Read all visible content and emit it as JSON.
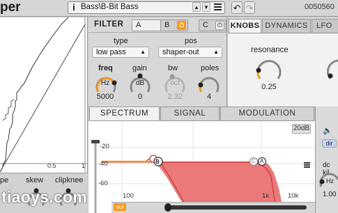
{
  "app": {
    "title_fragment": "per"
  },
  "preset": {
    "name": "Bass\\B-Bit Bass",
    "info_glyph": "i",
    "up_glyph": "▲",
    "down_glyph": "▼"
  },
  "toolbar": {
    "undo_glyph": "↶",
    "redo_glyph": "↷",
    "sample_counter": "0050560"
  },
  "shaper": {
    "tick_05": "0.5",
    "tick_1": "1",
    "knobs": [
      {
        "label": "pe"
      },
      {
        "label": "skew"
      },
      {
        "label": "clipknee"
      }
    ]
  },
  "filter": {
    "title": "FILTER",
    "slots": [
      {
        "label": "A",
        "power": "on"
      },
      {
        "label": "B",
        "power": "on"
      },
      {
        "label": "C",
        "power": "off"
      }
    ],
    "power_glyph": "⏻",
    "type_label": "type",
    "type_value": "low pass",
    "pos_label": "pos",
    "pos_value": "shaper-out",
    "knobs": [
      {
        "label": "freq",
        "inner": "Hz",
        "value": "5000"
      },
      {
        "label": "gain",
        "inner": "dB",
        "value": "0"
      },
      {
        "label": "bw",
        "inner": "oct",
        "value": "2.32"
      },
      {
        "label": "poles",
        "inner": "",
        "value": "4"
      }
    ]
  },
  "right_tabs": {
    "tabs": [
      {
        "label": "KNOBS",
        "active": true
      },
      {
        "label": "DYNAMICS",
        "active": false
      },
      {
        "label": "LFO A",
        "active": false
      }
    ],
    "resonance_label": "resonance",
    "resonance_value": "0.25"
  },
  "lower_tabs": [
    {
      "label": "SPECTRUM",
      "active": true
    },
    {
      "label": "SIGNAL",
      "active": false
    },
    {
      "label": "MODULATION",
      "active": false
    }
  ],
  "spectrum": {
    "db_range": "20dB",
    "db_ticks": [
      "-20",
      "-40",
      "-60"
    ],
    "freq_ticks": [
      "100",
      "1k",
      "10k"
    ],
    "handles": [
      "B",
      "C",
      "A"
    ],
    "out_label": "out"
  },
  "side": {
    "speaker_glyph": "🔈",
    "dir_label": "dir",
    "dc_label": "dc kil",
    "hz_label": "Hz",
    "value_fragment": "1.00"
  },
  "watermark": "tiaoys.com",
  "colors": {
    "accent": "#f39a1e",
    "filter_fill": "#e96a6a",
    "line": "#c83a3a"
  }
}
